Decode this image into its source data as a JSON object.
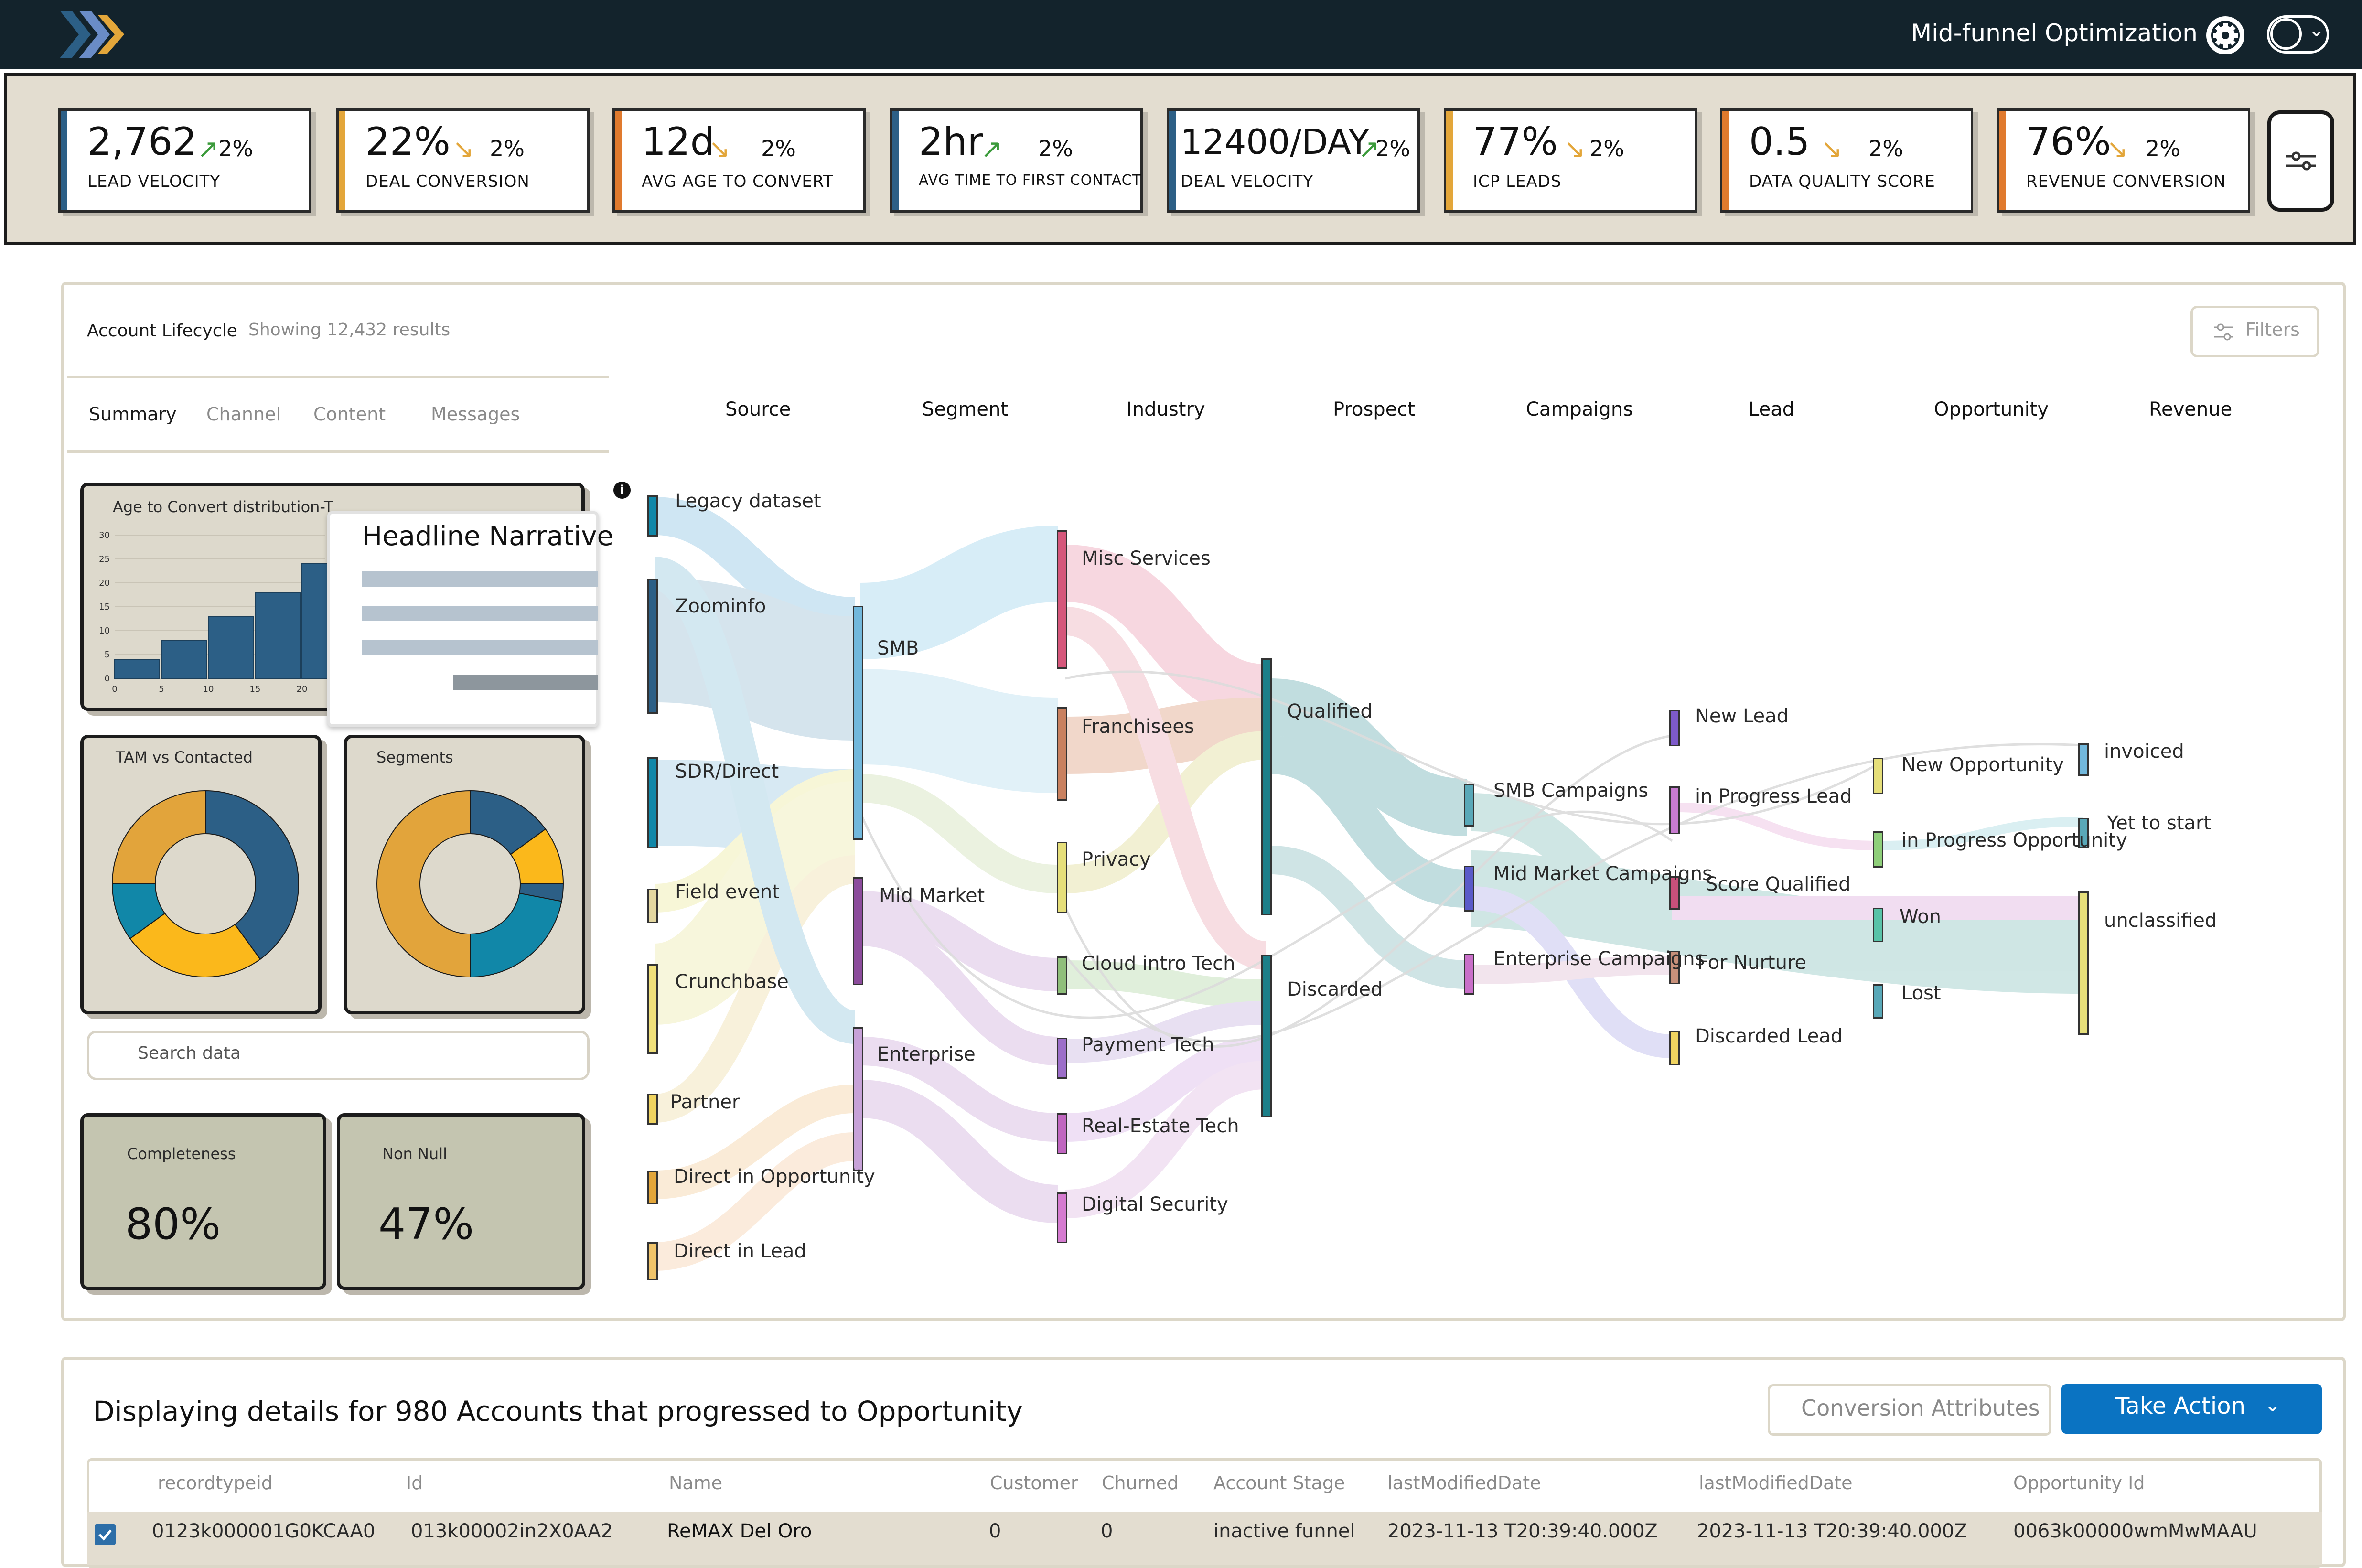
{
  "header": {
    "workspace_label": "Mid-funnel Optimization",
    "icons": [
      "logo-chevrons-icon",
      "gear-icon",
      "user-avatar-icon",
      "chevron-down-icon"
    ]
  },
  "kpis": [
    {
      "value": "2,762",
      "trend": "up",
      "change": "2%",
      "label": "LEAD VELOCITY",
      "accent": "#2c5f86"
    },
    {
      "value": "22%",
      "trend": "down",
      "change": "2%",
      "label": "DEAL CONVERSION",
      "accent": "#e3a63a"
    },
    {
      "value": "12d",
      "trend": "down",
      "change": "2%",
      "label": "AVG AGE TO CONVERT",
      "accent": "#e07a2e"
    },
    {
      "value": "2hr",
      "trend": "up",
      "change": "2%",
      "label": "AVG TIME TO FIRST CONTACT",
      "accent": "#2c5f86"
    },
    {
      "value": "12400/DAY",
      "trend": "up",
      "change": "2%",
      "label": "DEAL VELOCITY",
      "accent": "#2c5f86"
    },
    {
      "value": "77%",
      "trend": "down",
      "change": "2%",
      "label": "ICP LEADS",
      "accent": "#e3a63a"
    },
    {
      "value": "0.5",
      "trend": "down",
      "change": "2%",
      "label": "DATA QUALITY SCORE",
      "accent": "#e07a2e"
    },
    {
      "value": "76%",
      "trend": "down",
      "change": "2%",
      "label": "REVENUE CONVERSION",
      "accent": "#e07a2e"
    }
  ],
  "colors": {
    "trend_up": "#3a9a3a",
    "trend_down": "#e3a63a",
    "primary_button": "#0a73c2"
  },
  "lifecycle": {
    "title": "Account Lifecycle",
    "results": "Showing 12,432 results",
    "filters_label": "Filters",
    "tabs": [
      "Summary",
      "Channel",
      "Content",
      "Messages"
    ],
    "active_tab": "Summary",
    "histogram_title": "Age to Convert distribution-T",
    "narrative_title": "Headline Narrative",
    "tam_title": "TAM vs Contacted",
    "segments_title": "Segments",
    "search_placeholder": "Search data",
    "completeness_label": "Completeness",
    "completeness_value": "80%",
    "nonnull_label": "Non Null",
    "nonnull_value": "47%"
  },
  "histogram_chart": {
    "type": "bar",
    "x_ticks": [
      "0",
      "5",
      "10",
      "15",
      "20"
    ],
    "y_ticks": [
      "0",
      "5",
      "10",
      "15",
      "20",
      "25",
      "30"
    ],
    "values": [
      4,
      8,
      13,
      18,
      24
    ]
  },
  "tam_chart": {
    "type": "pie",
    "values": [
      40,
      25,
      10,
      25
    ],
    "colors": [
      "#2c5f86",
      "#fbb81b",
      "#1187a8",
      "#e2a43b"
    ]
  },
  "segments_chart": {
    "type": "pie",
    "values": [
      15,
      10,
      3,
      22,
      50
    ],
    "colors": [
      "#2c5f86",
      "#fbb81b",
      "#2c5f86",
      "#1187a8",
      "#e2a43b"
    ]
  },
  "sankey": {
    "columns": [
      "Source",
      "Segment",
      "Industry",
      "Prospect",
      "Campaigns",
      "Lead",
      "Opportunity",
      "Revenue"
    ],
    "nodes": {
      "source": [
        "Legacy dataset",
        "Zoominfo",
        "SDR/Direct",
        "Field event",
        "Crunchbase",
        "Partner",
        "Direct in Opportunity",
        "Direct in Lead"
      ],
      "segment": [
        "SMB",
        "Mid Market",
        "Enterprise"
      ],
      "industry": [
        "Misc Services",
        "Franchisees",
        "Privacy",
        "Cloud intro Tech",
        "Payment Tech",
        "Real-Estate Tech",
        "Digital Security"
      ],
      "prospect": [
        "Qualified",
        "Discarded"
      ],
      "campaigns": [
        "SMB Campaigns",
        "Mid Market Campaigns",
        "Enterprise Campaigns"
      ],
      "lead": [
        "New Lead",
        "in Progress Lead",
        "Score Qualified",
        "For Nurture",
        "Discarded Lead"
      ],
      "opportunity": [
        "New Opportunity",
        "in Progress Opportunity",
        "Won",
        "Lost"
      ],
      "revenue": [
        "invoiced",
        "Yet to start",
        "unclassified"
      ]
    }
  },
  "details": {
    "title": "Displaying details for 980 Accounts that progressed to Opportunity",
    "conversion_button": "Conversion Attributes",
    "action_button": "Take Action",
    "columns": [
      "recordtypeid",
      "Id",
      "Name",
      "Customer",
      "Churned",
      "Account Stage",
      "lastModifiedDate",
      "lastModifiedDate",
      "Opportunity Id"
    ],
    "rows": [
      [
        "0123k000001G0KCAA0",
        "013k00002in2X0AA2",
        "ReMAX Del Oro",
        "0",
        "0",
        "inactive funnel",
        "2023-11-13 T20:39:40.000Z",
        "2023-11-13 T20:39:40.000Z",
        "0063k00000wmMwMAAU"
      ]
    ]
  }
}
